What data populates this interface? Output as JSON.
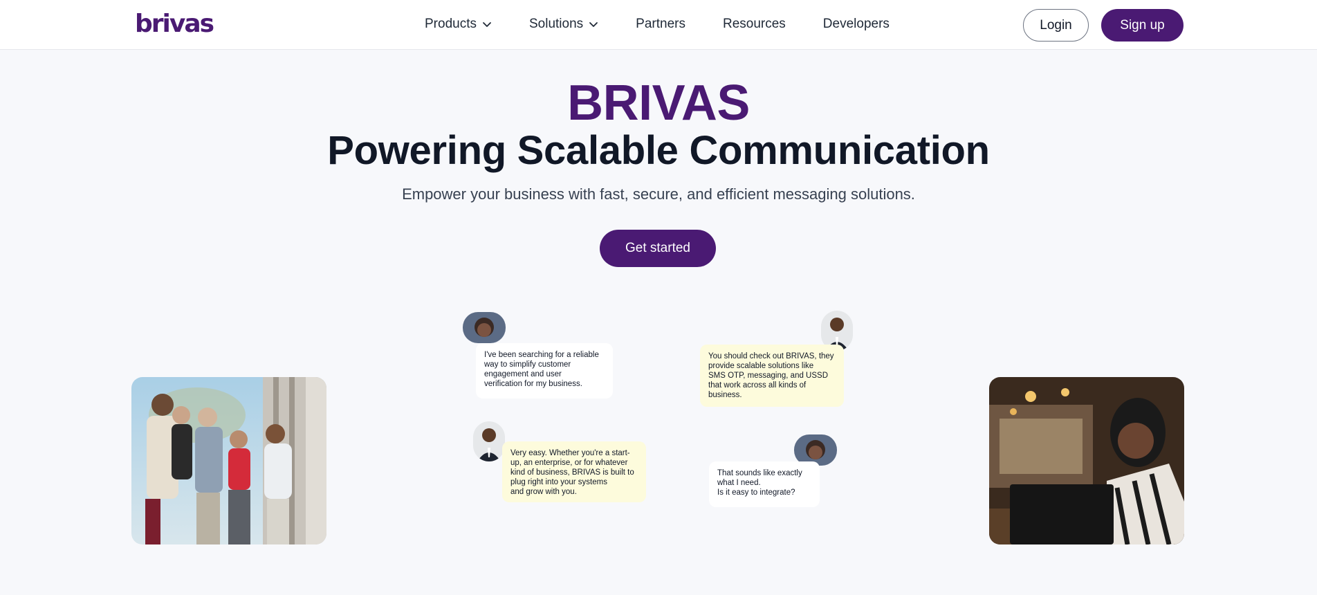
{
  "nav": {
    "logo": "brivas",
    "items": [
      {
        "label": "Products",
        "dropdown": true
      },
      {
        "label": "Solutions",
        "dropdown": true
      },
      {
        "label": "Partners",
        "dropdown": false
      },
      {
        "label": "Resources",
        "dropdown": false
      },
      {
        "label": "Developers",
        "dropdown": false
      }
    ],
    "login_label": "Login",
    "signup_label": "Sign up"
  },
  "hero": {
    "brand": "BRIVAS",
    "headline": "Powering Scalable Communication",
    "subhead": "Empower your business with fast, secure, and efficient messaging solutions.",
    "cta_label": "Get started"
  },
  "chat": [
    {
      "text": "I've been searching for a reliable\nway to simplify customer\nengagement and user\nverification for my business."
    },
    {
      "text": "You should check out BRIVAS, they\nprovide scalable solutions like\nSMS OTP, messaging, and USSD\nthat work across all kinds of\nbusiness."
    },
    {
      "text": "Very easy. Whether you're a start-\nup, an enterprise, or for whatever\nkind of business, BRIVAS is built to\nplug right into your systems\nand grow with you."
    },
    {
      "text": "That sounds like exactly\nwhat I need.\nIs it easy to integrate?"
    }
  ],
  "colors": {
    "brand": "#4a1a73",
    "page_bg": "#f7f8fb",
    "bubble_yellow": "#fdfbdc",
    "bubble_white": "#ffffff"
  }
}
